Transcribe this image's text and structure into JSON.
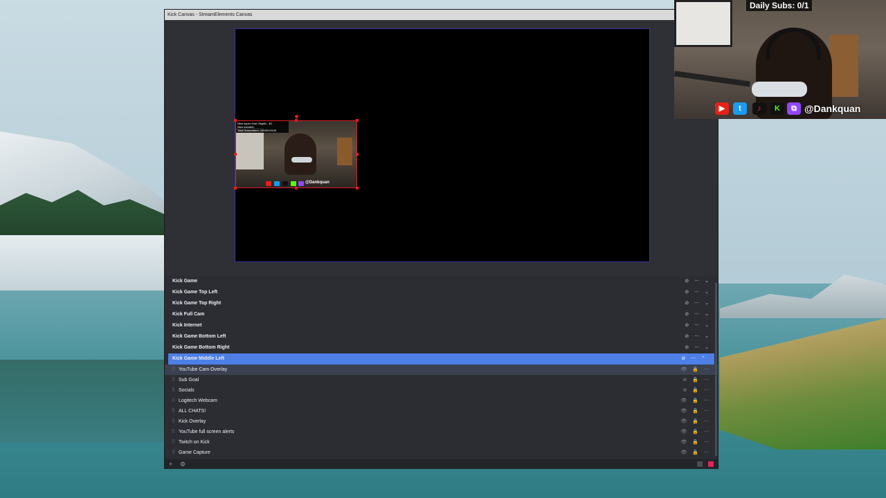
{
  "window": {
    "title": "Kick Canvas - StreamElements Canvas"
  },
  "preview_source": {
    "info_lines": [
      "New super chat: Glyptic - $1",
      "New member:",
      "Total Subscribers: 19000/19100"
    ],
    "handle": "@Dankquan"
  },
  "layers": {
    "groups": [
      {
        "label": "Kick Game"
      },
      {
        "label": "Kick Game Top Left"
      },
      {
        "label": "Kick Game Top Right"
      },
      {
        "label": "Kick Full Cam"
      },
      {
        "label": "Kick Internet"
      },
      {
        "label": "Kick Game Bottom Left"
      },
      {
        "label": "Kick Game Bottom Right"
      },
      {
        "label": "Kick Game Middle Left"
      }
    ],
    "items": [
      {
        "label": "YouTube Cam Overlay"
      },
      {
        "label": "Sub Goal"
      },
      {
        "label": "Socials"
      },
      {
        "label": "Logitech Webcam"
      },
      {
        "label": "ALL CHATS!"
      },
      {
        "label": "Kick Overlay"
      },
      {
        "label": "YouTube full screen alerts"
      },
      {
        "label": "Twitch on Kick"
      },
      {
        "label": "Game Capture"
      }
    ]
  },
  "webcam_overlay": {
    "subs_label": "Daily Subs: 0/1",
    "handle": "@Dankquan",
    "social_icons": [
      "youtube-icon",
      "twitter-icon",
      "tiktok-icon",
      "kick-icon",
      "twitch-icon"
    ]
  },
  "colors": {
    "selection": "#4d7fe6",
    "bounding_box": "#e01b24",
    "preview_border": "#3b2fa8",
    "record_button": "#e0245e"
  }
}
